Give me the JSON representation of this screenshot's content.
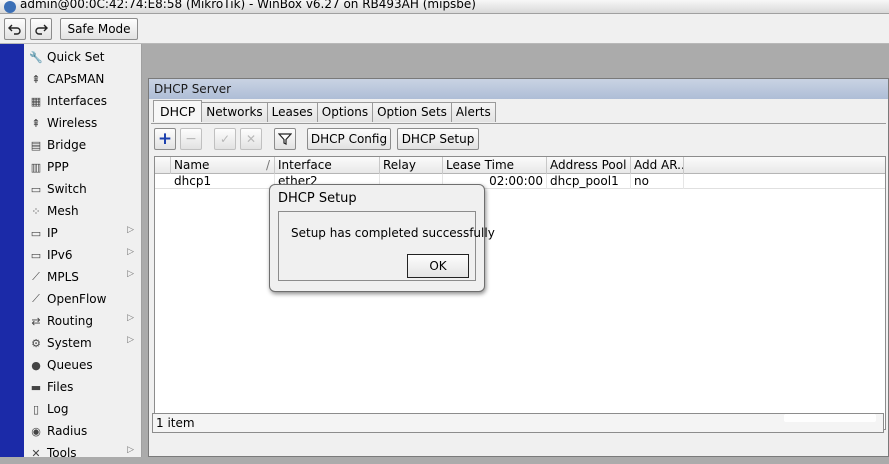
{
  "window": {
    "title": "admin@00:0C:42:74:E8:58 (MikroTik) - WinBox v6.27 on RB493AH (mipsbe)"
  },
  "toolbar": {
    "undo_icon": "undo-icon",
    "redo_icon": "redo-icon",
    "safe_mode_label": "Safe Mode"
  },
  "menu": {
    "items": [
      {
        "label": "Quick Set",
        "icon": "quick-set-icon",
        "glyph": "🔧",
        "submenu": false
      },
      {
        "label": "CAPsMAN",
        "icon": "capsman-icon",
        "glyph": "⇞",
        "submenu": false
      },
      {
        "label": "Interfaces",
        "icon": "interfaces-icon",
        "glyph": "▦",
        "submenu": false
      },
      {
        "label": "Wireless",
        "icon": "wireless-icon",
        "glyph": "⇞",
        "submenu": false
      },
      {
        "label": "Bridge",
        "icon": "bridge-icon",
        "glyph": "▤",
        "submenu": false
      },
      {
        "label": "PPP",
        "icon": "ppp-icon",
        "glyph": "▥",
        "submenu": false
      },
      {
        "label": "Switch",
        "icon": "switch-icon",
        "glyph": "▭",
        "submenu": false
      },
      {
        "label": "Mesh",
        "icon": "mesh-icon",
        "glyph": "⁘",
        "submenu": false
      },
      {
        "label": "IP",
        "icon": "ip-icon",
        "glyph": "▭",
        "submenu": true
      },
      {
        "label": "IPv6",
        "icon": "ipv6-icon",
        "glyph": "▭",
        "submenu": true
      },
      {
        "label": "MPLS",
        "icon": "mpls-icon",
        "glyph": "⟋",
        "submenu": true
      },
      {
        "label": "OpenFlow",
        "icon": "openflow-icon",
        "glyph": "⟋",
        "submenu": false
      },
      {
        "label": "Routing",
        "icon": "routing-icon",
        "glyph": "⇄",
        "submenu": true
      },
      {
        "label": "System",
        "icon": "system-icon",
        "glyph": "⚙",
        "submenu": true
      },
      {
        "label": "Queues",
        "icon": "queues-icon",
        "glyph": "●",
        "submenu": false
      },
      {
        "label": "Files",
        "icon": "files-icon",
        "glyph": "▬",
        "submenu": false
      },
      {
        "label": "Log",
        "icon": "log-icon",
        "glyph": "▯",
        "submenu": false
      },
      {
        "label": "Radius",
        "icon": "radius-icon",
        "glyph": "◉",
        "submenu": false
      },
      {
        "label": "Tools",
        "icon": "tools-icon",
        "glyph": "✕",
        "submenu": true
      }
    ]
  },
  "dhcp_window": {
    "title": "DHCP Server",
    "tabs": [
      "DHCP",
      "Networks",
      "Leases",
      "Options",
      "Option Sets",
      "Alerts"
    ],
    "active_tab": "DHCP",
    "buttons": {
      "add": "+",
      "remove": "−",
      "enable": "✓",
      "disable": "✕",
      "filter_icon": "filter-icon",
      "dhcp_config": "DHCP Config",
      "dhcp_setup": "DHCP Setup"
    },
    "columns": [
      "Name",
      "Interface",
      "Relay",
      "Lease Time",
      "Address Pool",
      "Add AR..."
    ],
    "sort_mark": "/",
    "rows": [
      {
        "name": "dhcp1",
        "interface": "ether2",
        "relay": "",
        "lease_time": "02:00:00",
        "address_pool": "dhcp_pool1",
        "add_arp": "no"
      }
    ],
    "status": "1 item"
  },
  "dialog": {
    "title": "DHCP Setup",
    "message": "Setup has completed successfully",
    "ok_label": "OK"
  },
  "colors": {
    "sidebar_strip": "#1b2aa8",
    "add_plus": "#1b3fae",
    "window_title": "#aebdd6"
  }
}
